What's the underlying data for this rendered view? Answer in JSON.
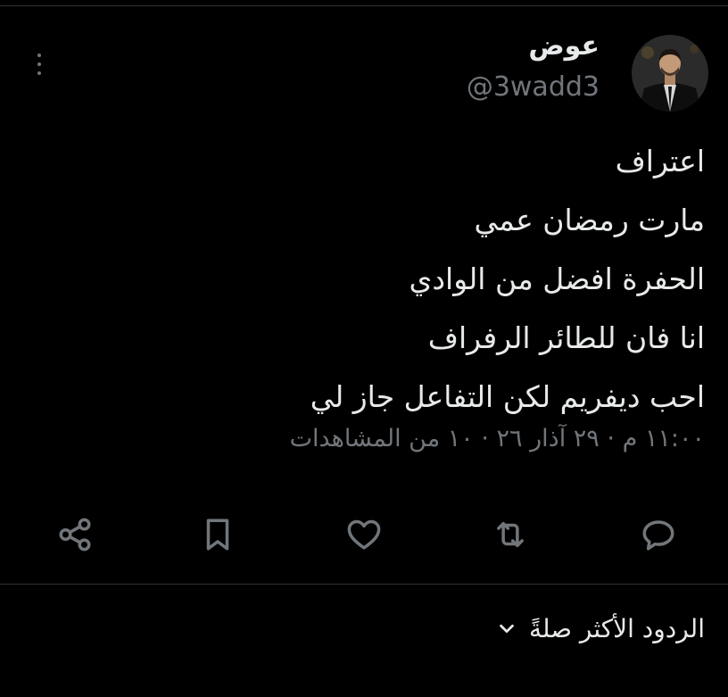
{
  "author": {
    "display_name": "عوض",
    "handle": "@3wadd3"
  },
  "tweet": {
    "lines": [
      "اعتراف",
      "مارت رمضان عمي",
      "الحفرة افضل من الوادي",
      "انا فان للطائر الرفراف",
      "احب ديفريم لكن التفاعل جاز لي"
    ],
    "meta": {
      "time": "١١:٠٠ م",
      "date": "٢٩ آذار ٢٦",
      "views": "١٠ من المشاهدات"
    }
  },
  "actions": {
    "icons": [
      "reply-icon",
      "retweet-icon",
      "like-icon",
      "bookmark-icon",
      "share-icon"
    ],
    "icon_color": "#71767b"
  },
  "replies_sort": {
    "label": "الردود الأكثر صلةً"
  },
  "colors": {
    "background": "#000000",
    "text_primary": "#e7e9ea",
    "text_secondary": "#71767b",
    "divider": "#2f3336"
  }
}
